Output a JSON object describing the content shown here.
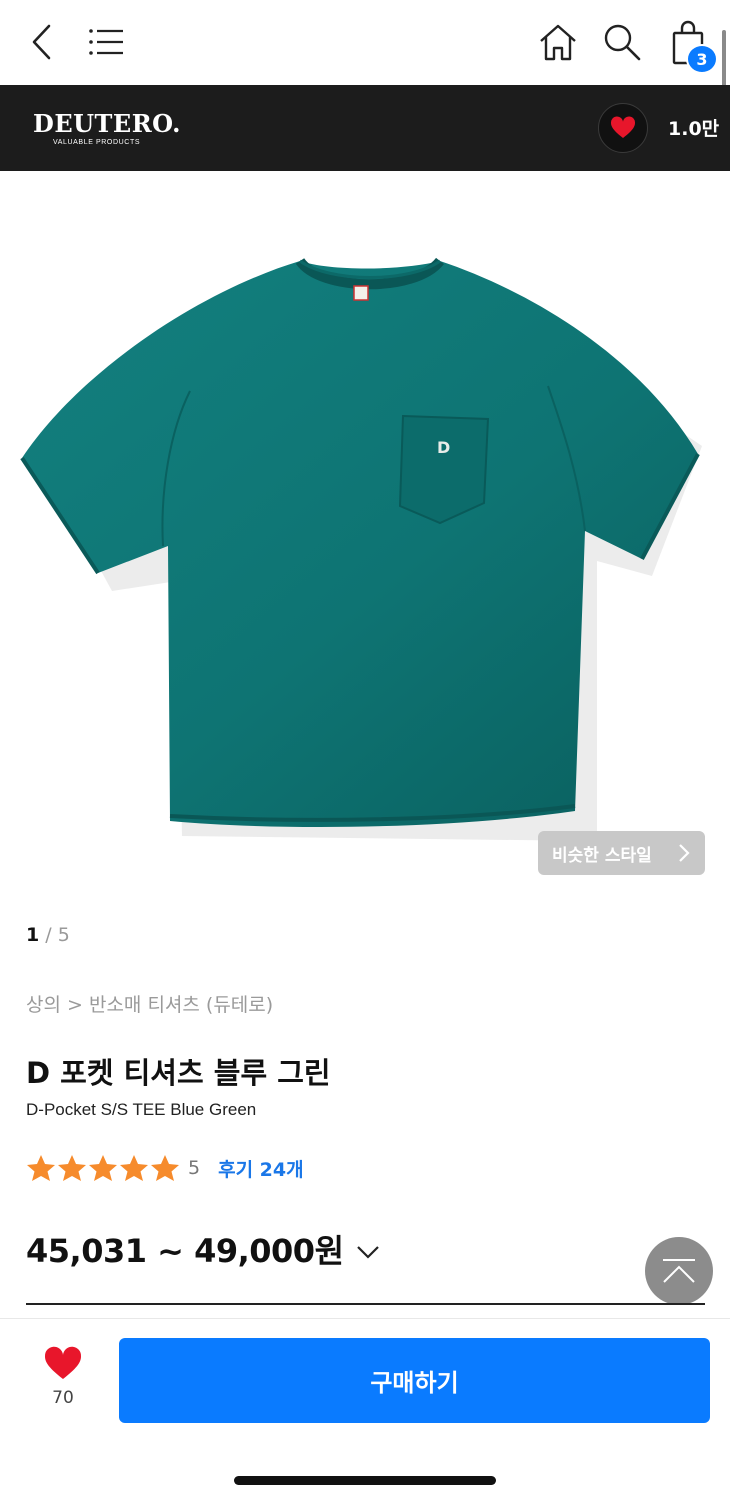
{
  "nav": {
    "cart_count": "3",
    "icons": [
      "back-arrow-icon",
      "menu-list-icon",
      "home-icon",
      "search-icon",
      "shopping-bag-icon"
    ]
  },
  "brand": {
    "name": "DEUTERO.",
    "tagline": "VALUABLE PRODUCTS",
    "like_count": "1.0만"
  },
  "gallery": {
    "current": "1",
    "separator": " / ",
    "total": "5",
    "similar_style_label": "비슷한 스타일"
  },
  "product": {
    "breadcrumb": "상의 > 반소매 티셔츠 (듀테로)",
    "title_ko": "D 포켓 티셔츠 블루 그린",
    "title_en": "D-Pocket S/S TEE Blue Green",
    "rating": 5,
    "rating_label": "5",
    "reviews_label": "후기 24개",
    "price": "45,031 ~ 49,000원",
    "shirt_color": "#0e7473",
    "pocket_letter": "D"
  },
  "bottom": {
    "wish_count": "70",
    "buy_label": "구매하기"
  },
  "colors": {
    "accent_blue": "#0a7bff",
    "link_blue": "#1a77e8",
    "heart_red": "#e8162b",
    "star_orange": "#f68b2c",
    "brand_bar": "#1c1c1c"
  }
}
